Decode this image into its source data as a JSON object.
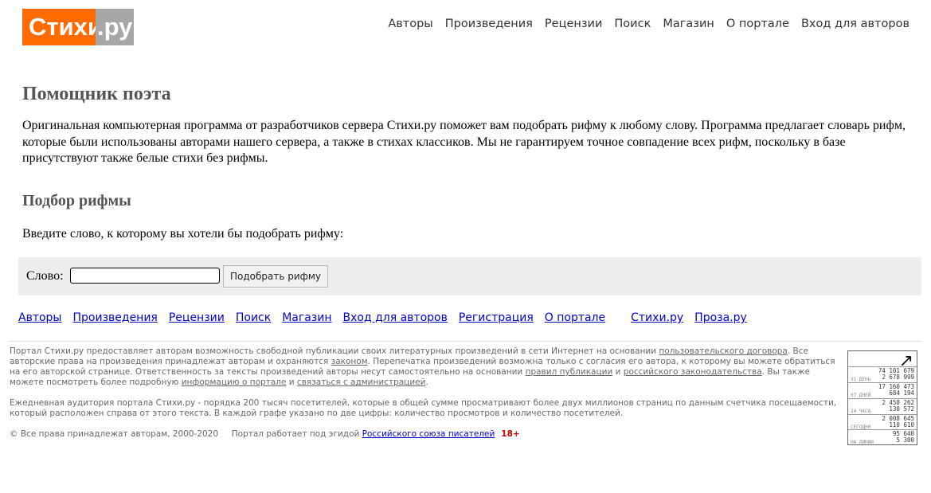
{
  "logo": {
    "main": "Стихи",
    "tld": ".ру"
  },
  "topnav": [
    "Авторы",
    "Произведения",
    "Рецензии",
    "Поиск",
    "Магазин",
    "О портале",
    "Вход для авторов"
  ],
  "main": {
    "title": "Помощник поэта",
    "intro": "Оригинальная компьютерная программа от разработчиков сервера Стихи.ру поможет вам подобрать рифму к любому слову. Программа предлагает словарь рифм, которые были использованы авторами нашего сервера, а также в стихах классиков. Мы не гарантируем точное совпадение всех рифм, поскольку в базе присутствуют также белые стихи без рифмы.",
    "subtitle": "Подбор рифмы",
    "prompt": "Введите слово, к которому вы хотели бы подобрать рифму:"
  },
  "form": {
    "label": "Слово:",
    "input_value": "",
    "button_label": "Подобрать рифму"
  },
  "bottomnav": {
    "links": [
      "Авторы",
      "Произведения",
      "Рецензии",
      "Поиск",
      "Магазин",
      "Вход для авторов",
      "Регистрация",
      "О портале"
    ],
    "sites": [
      "Стихи.ру",
      "Проза.ру"
    ]
  },
  "footer": {
    "p1": {
      "t1": "Портал Стихи.ру предоставляет авторам возможность свободной публикации своих литературных произведений в сети Интернет на основании ",
      "l1": "пользовательского договора",
      "t2": ". Все авторские права на произведения принадлежат авторам и охраняются ",
      "l2": "законом",
      "t3": ". Перепечатка произведений возможна только с согласия его автора, к которому вы можете обратиться на его авторской странице. Ответственность за тексты произведений авторы несут самостоятельно на основании ",
      "l3": "правил публикации",
      "t4": " и ",
      "l4": "российского законодательства",
      "t5": ". Вы также можете посмотреть более подробную ",
      "l5": "информацию о портале",
      "t6": " и ",
      "l6": "связаться с администрацией",
      "t7": "."
    },
    "p2": "Ежедневная аудитория портала Стихи.ру - порядка 200 тысяч посетителей, которые в общей сумме просматривают более двух миллионов страниц по данным счетчика посещаемости, который расположен справа от этого текста. В каждой графе указано по две цифры: количество просмотров и количество посетителей.",
    "p3": {
      "copyright": "© Все права принадлежат авторам, 2000-2020",
      "patron": "Портал работает под эгидой ",
      "patron_link": "Российского союза писателей",
      "age": "18+"
    }
  },
  "counter": {
    "arrow": "↗",
    "rows": [
      {
        "label": "31 ДЕНЬ",
        "views": "74 101 679",
        "visitors": "2 678 999"
      },
      {
        "label": "07 ДНЕЙ",
        "views": "17 160 473",
        "visitors": "684 194"
      },
      {
        "label": "24 ЧАСА",
        "views": "2 458 262",
        "visitors": "130 572"
      },
      {
        "label": "СЕГОДНЯ",
        "views": "2 008 645",
        "visitors": "110 610"
      },
      {
        "label": "НА ЛИНИИ",
        "views": "95 640",
        "visitors": "5 300"
      }
    ]
  }
}
